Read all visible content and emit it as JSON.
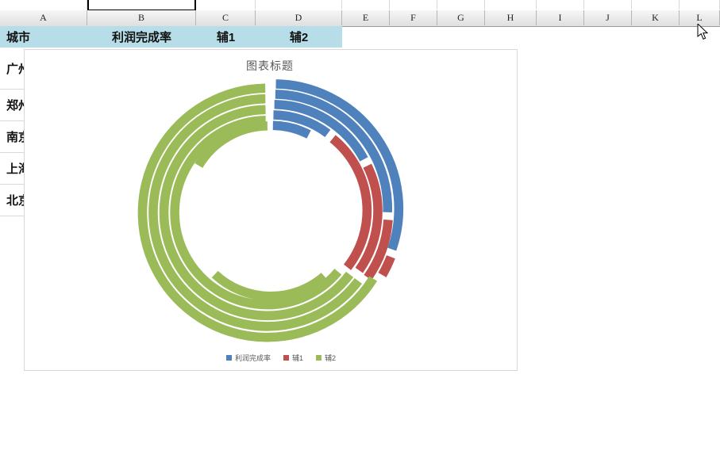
{
  "sheet": {
    "column_letters": [
      "A",
      "B",
      "C",
      "D",
      "E",
      "F",
      "G",
      "H",
      "I",
      "J",
      "K",
      "L"
    ],
    "header_row": {
      "cells": [
        {
          "label": "城市"
        },
        {
          "label": "利润完成率"
        },
        {
          "label": "辅1"
        },
        {
          "label": "辅2"
        }
      ]
    },
    "city_rows": [
      "广州",
      "郑州",
      "南京",
      "上海",
      "北京"
    ]
  },
  "chart_data": {
    "type": "doughnut",
    "title": "图表标题",
    "legend_position": "bottom",
    "categories": [
      "利润完成率",
      "辅1",
      "辅2"
    ],
    "legend": [
      {
        "label": "利润完成率",
        "color": "#4f81bd"
      },
      {
        "label": "辅1",
        "color": "#c0504d"
      },
      {
        "label": "辅2",
        "color": "#9bbb59"
      }
    ],
    "colors": {
      "利润完成率": "#4f81bd",
      "辅1": "#c0504d",
      "辅2": "#9bbb59"
    },
    "rings_inner_to_outer": [
      {
        "series": "广州",
        "implied_completion_rate_pct": 23,
        "segments": [
          {
            "category": "利润完成率",
            "color": "#4f81bd",
            "start_deg": 0,
            "end_deg": 28
          },
          {
            "category": "辅2",
            "color": "#9bbb59",
            "start_deg": 138,
            "end_deg": 224
          },
          {
            "category": "辅2",
            "color": "#9bbb59",
            "start_deg": 300,
            "end_deg": 360
          }
        ]
      },
      {
        "series": "郑州",
        "implied_completion_rate_pct": 30,
        "segments": [
          {
            "category": "利润完成率",
            "color": "#4f81bd",
            "start_deg": 0,
            "end_deg": 38
          },
          {
            "category": "辅1",
            "color": "#c0504d",
            "start_deg": 38,
            "end_deg": 129
          },
          {
            "category": "辅2",
            "color": "#9bbb59",
            "start_deg": 129,
            "end_deg": 360
          }
        ]
      },
      {
        "series": "南京",
        "implied_completion_rate_pct": 50,
        "segments": [
          {
            "category": "利润完成率",
            "color": "#4f81bd",
            "start_deg": 0,
            "end_deg": 63
          },
          {
            "category": "辅1",
            "color": "#c0504d",
            "start_deg": 63,
            "end_deg": 126
          },
          {
            "category": "辅2",
            "color": "#9bbb59",
            "start_deg": 126,
            "end_deg": 360
          }
        ]
      },
      {
        "series": "上海",
        "implied_completion_rate_pct": 74,
        "segments": [
          {
            "category": "利润完成率",
            "color": "#4f81bd",
            "start_deg": 0,
            "end_deg": 93
          },
          {
            "category": "辅1",
            "color": "#c0504d",
            "start_deg": 93,
            "end_deg": 126
          },
          {
            "category": "辅2",
            "color": "#9bbb59",
            "start_deg": 126,
            "end_deg": 360
          }
        ]
      },
      {
        "series": "北京",
        "implied_completion_rate_pct": 91,
        "segments": [
          {
            "category": "利润完成率",
            "color": "#4f81bd",
            "start_deg": 0,
            "end_deg": 110
          },
          {
            "category": "辅1",
            "color": "#c0504d",
            "start_deg": 110,
            "end_deg": 121
          },
          {
            "category": "辅2",
            "color": "#9bbb59",
            "start_deg": 121,
            "end_deg": 360
          }
        ]
      }
    ]
  }
}
